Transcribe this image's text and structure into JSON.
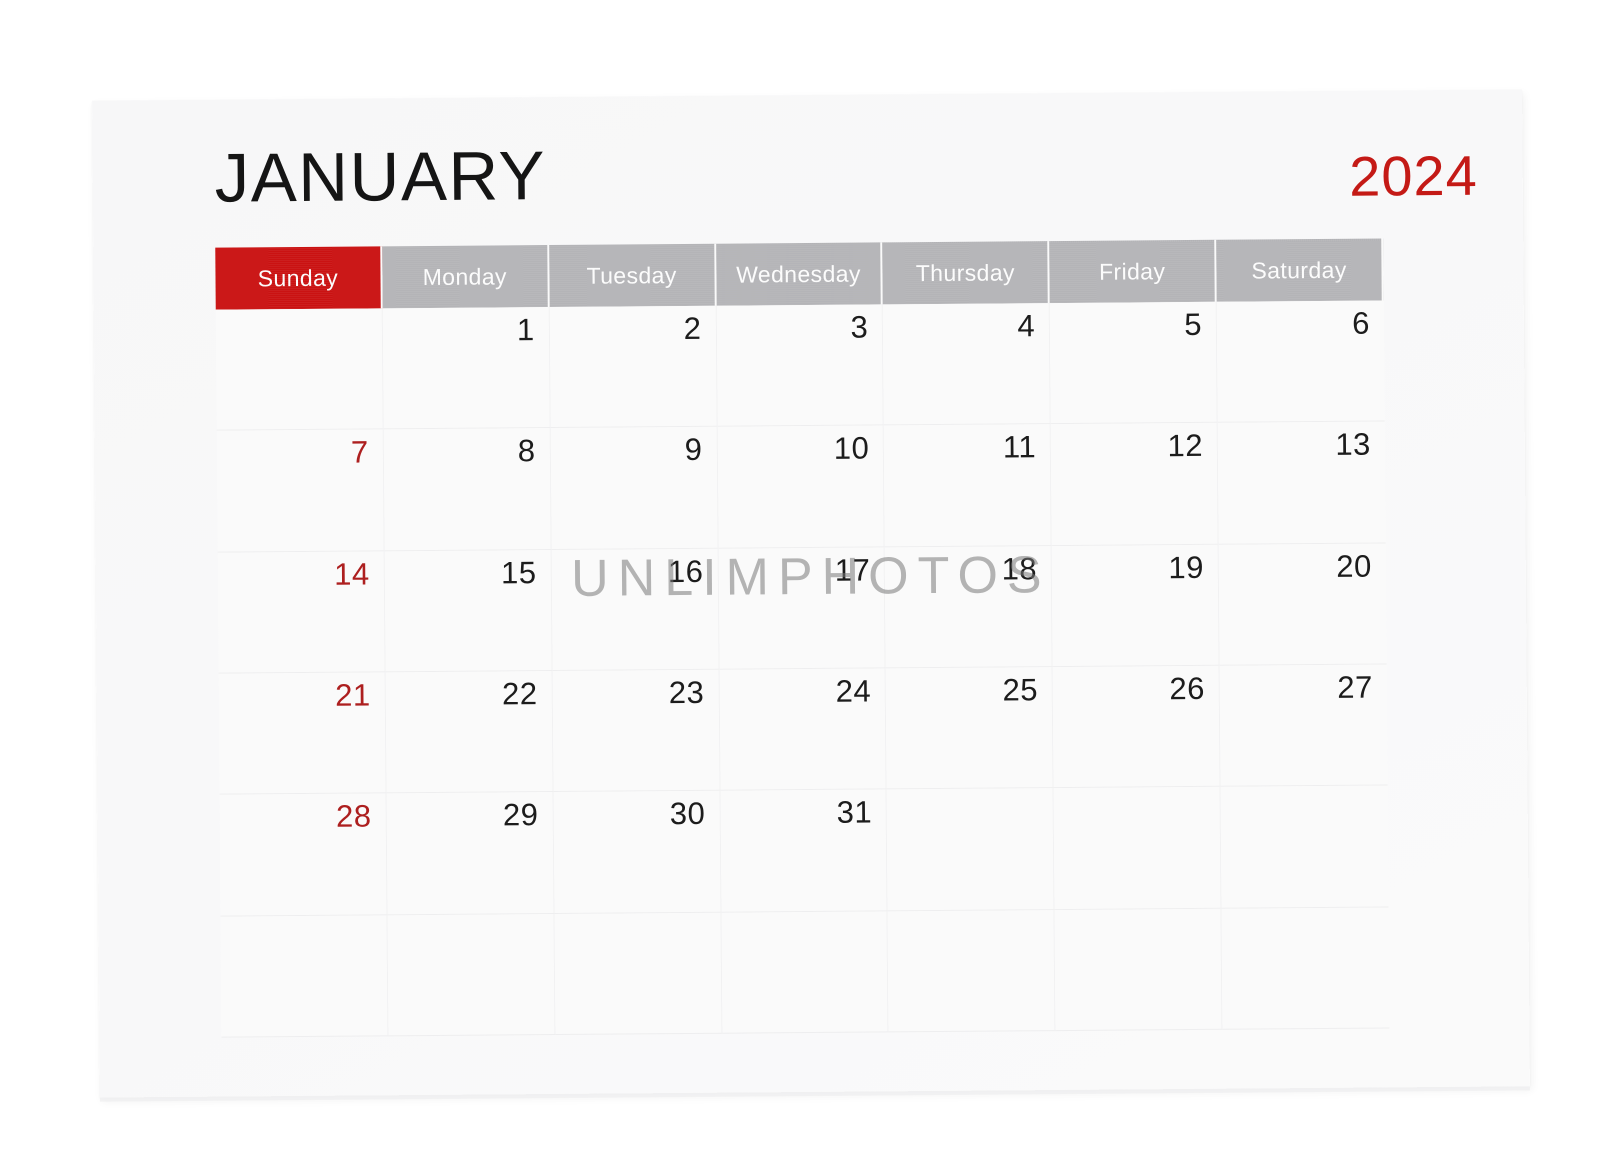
{
  "calendar": {
    "month": "JANUARY",
    "year": "2024",
    "weekday_headers": [
      "Sunday",
      "Monday",
      "Tuesday",
      "Wednesday",
      "Thursday",
      "Friday",
      "Saturday"
    ],
    "weeks": [
      [
        "",
        "1",
        "2",
        "3",
        "4",
        "5",
        "6"
      ],
      [
        "7",
        "8",
        "9",
        "10",
        "11",
        "12",
        "13"
      ],
      [
        "14",
        "15",
        "16",
        "17",
        "18",
        "19",
        "20"
      ],
      [
        "21",
        "22",
        "23",
        "24",
        "25",
        "26",
        "27"
      ],
      [
        "28",
        "29",
        "30",
        "31",
        "",
        "",
        ""
      ],
      [
        "",
        "",
        "",
        "",
        "",
        "",
        ""
      ]
    ],
    "colors": {
      "sunday_header_background": "#cc1212",
      "weekday_header_background": "#b6b6b9",
      "header_text": "#ffffff",
      "year_text": "#c41a16",
      "sunday_date_text": "#ad1f1f",
      "date_text": "#1c1c1c",
      "page_background": "#f8f8f9"
    }
  },
  "watermark": {
    "text": "UNLIMPHOTOS"
  }
}
